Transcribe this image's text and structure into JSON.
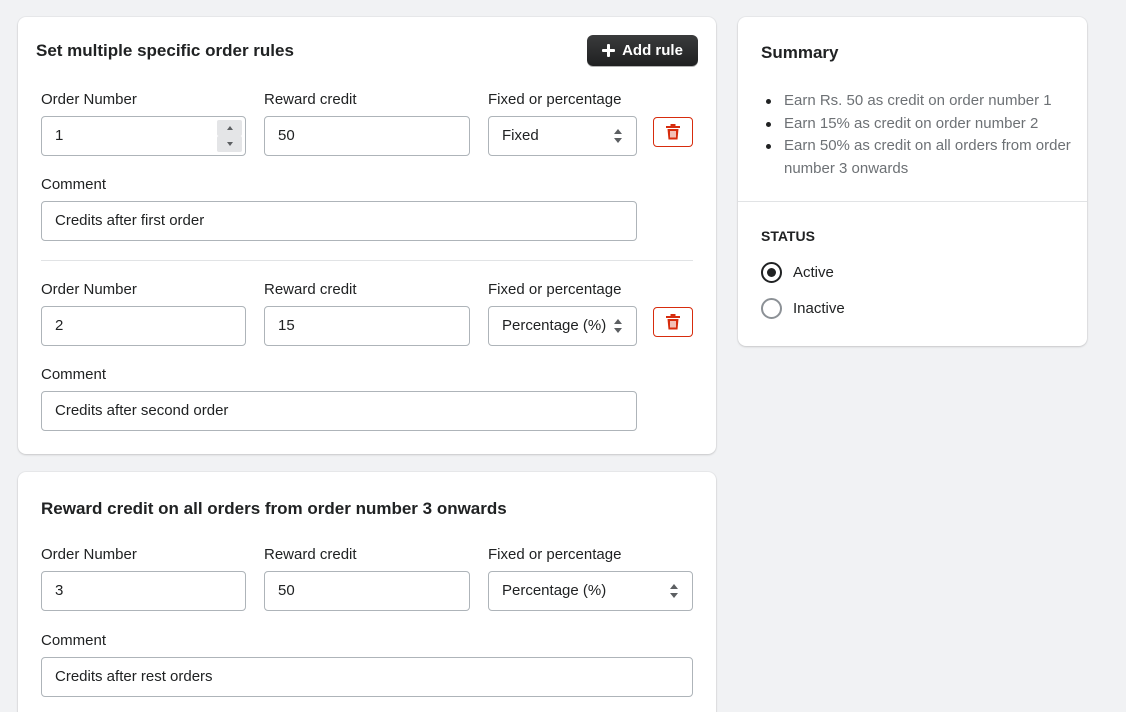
{
  "rules_card": {
    "title": "Set multiple specific order rules",
    "add_rule_label": "Add rule",
    "rules": [
      {
        "order_number_label": "Order Number",
        "order_number": "1",
        "reward_credit_label": "Reward credit",
        "reward_credit": "50",
        "type_label": "Fixed or percentage",
        "type": "Fixed",
        "comment_label": "Comment",
        "comment": "Credits after first order"
      },
      {
        "order_number_label": "Order Number",
        "order_number": "2",
        "reward_credit_label": "Reward credit",
        "reward_credit": "15",
        "type_label": "Fixed or percentage",
        "type": "Percentage (%)",
        "comment_label": "Comment",
        "comment": "Credits after second order"
      }
    ]
  },
  "onwards_card": {
    "title": "Reward credit on all orders from order number 3 onwards",
    "order_number_label": "Order Number",
    "order_number": "3",
    "reward_credit_label": "Reward credit",
    "reward_credit": "50",
    "type_label": "Fixed or percentage",
    "type": "Percentage (%)",
    "comment_label": "Comment",
    "comment": "Credits after rest orders"
  },
  "summary_card": {
    "title": "Summary",
    "items": [
      "Earn Rs. 50 as credit on order number 1",
      "Earn 15% as credit on order number 2",
      "Earn 50% as credit on all orders from order number 3 onwards"
    ],
    "status_heading": "STATUS",
    "status_options": [
      "Active",
      "Inactive"
    ],
    "status_selected": "Active"
  },
  "colors": {
    "page_background": "#f1f2f4",
    "delete_red": "#d72c0d",
    "primary_button": "#303030",
    "muted_text": "#6d7175"
  },
  "icons": {
    "add": "plus-icon",
    "delete": "trash-icon",
    "stepper": "stepper-arrows-icon",
    "select": "select-arrows-icon"
  }
}
